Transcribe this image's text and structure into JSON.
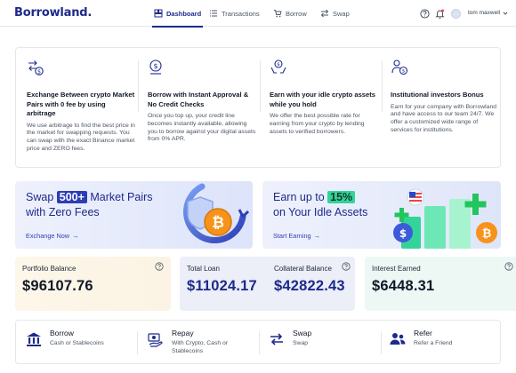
{
  "app": {
    "logo": "Borrowland."
  },
  "nav": {
    "items": [
      {
        "label": "Dashboard",
        "active": true
      },
      {
        "label": "Transactions",
        "active": false
      },
      {
        "label": "Borrow",
        "active": false
      },
      {
        "label": "Swap",
        "active": false
      }
    ],
    "user": {
      "name": "tom maxwell"
    }
  },
  "features": [
    {
      "icon": "exchange-dollar-icon",
      "title": "Exchange Between crypto Market Pairs with 0 fee by using arbitrage",
      "desc": "We use arbitrage to find the best price in the market for swapping requests. You can swap with the exact Binance market price and ZERO fees."
    },
    {
      "icon": "dollar-coin-icon",
      "title": "Borrow with Instant Approval & No Credit Checks",
      "desc": "Once you top up, your credit line becomes instantly available, allowing you to borrow against your digital assets from 0% APR."
    },
    {
      "icon": "hands-coin-icon",
      "title": "Earn with your idle crypto assets while you hold",
      "desc": "We offer the best possible rate for earning from your crypto by lending assets to verified borrowers."
    },
    {
      "icon": "investor-icon",
      "title": "Institutional investors Bonus",
      "desc": "Earn for your company with Borrowland and have access to our team 24/7. We offer a customized wide range of services for institutions."
    }
  ],
  "banners": {
    "swap": {
      "pre": "Swap ",
      "badge": "500+",
      "post": " Market Pairs",
      "line2": "with Zero Fees",
      "link": "Exchange Now"
    },
    "earn": {
      "pre": "Earn up to ",
      "badge": "15%",
      "line2": "on Your Idle Assets",
      "link": "Start Earning"
    }
  },
  "stats": [
    {
      "label": "Portfolio Balance",
      "value": "$96107.76"
    },
    {
      "label": "Total Loan",
      "value": "$11024.17"
    },
    {
      "label": "Collateral Balance",
      "value": "$42822.43"
    },
    {
      "label": "Interest Earned",
      "value": "$6448.31"
    }
  ],
  "actions": [
    {
      "icon": "bank-icon",
      "title": "Borrow",
      "sub": "Cash or Stablecoins"
    },
    {
      "icon": "repay-icon",
      "title": "Repay",
      "sub": "With Crypto, Cash or Stablecoins"
    },
    {
      "icon": "swap-icon",
      "title": "Swap",
      "sub": "Swap"
    },
    {
      "icon": "refer-icon",
      "title": "Refer",
      "sub": "Refer a Friend"
    }
  ],
  "colors": {
    "brand": "#1d2a8a",
    "accent_blue": "#2c3eb5",
    "accent_green": "#34d399",
    "portfolio_bg": "#fdf6e9",
    "loan_bg": "#eceef8",
    "interest_bg": "#edf8f4"
  }
}
